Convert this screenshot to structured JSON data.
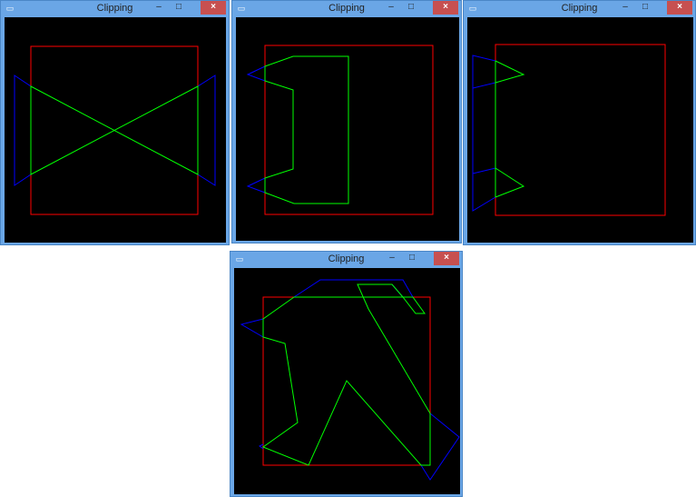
{
  "windows": [
    {
      "title": "Clipping",
      "controls": {
        "minimize": "–",
        "maximize": "□",
        "close": "×"
      },
      "icon": "app-window-icon"
    },
    {
      "title": "Clipping",
      "controls": {
        "minimize": "–",
        "maximize": "□",
        "close": "×"
      },
      "icon": "app-window-icon"
    },
    {
      "title": "Clipping",
      "controls": {
        "minimize": "–",
        "maximize": "□",
        "close": "×"
      },
      "icon": "app-window-icon"
    },
    {
      "title": "Clipping",
      "controls": {
        "minimize": "–",
        "maximize": "□",
        "close": "×"
      },
      "icon": "app-window-icon"
    }
  ],
  "colors": {
    "clip_window": "#ff0000",
    "original_polygon": "#0000ff",
    "clipped_polygon": "#00ff00",
    "canvas_background": "#000000",
    "window_frame": "#6aa6e6",
    "close_button": "#c75050"
  }
}
